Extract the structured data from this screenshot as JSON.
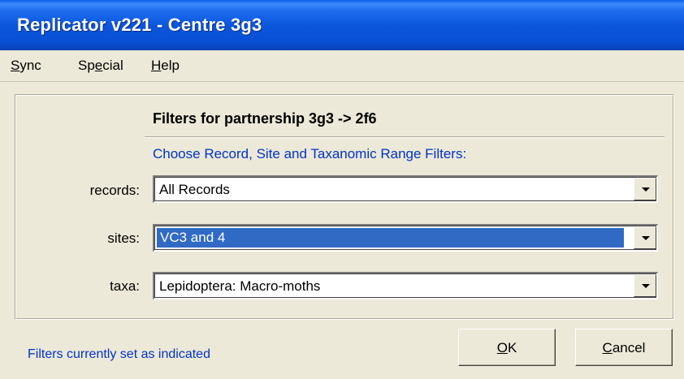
{
  "window": {
    "title": "Replicator v221 - Centre 3g3"
  },
  "menu": {
    "items": [
      {
        "label_first": "S",
        "label_rest": "ync"
      },
      {
        "label_first": "Sp",
        "label_under": "e",
        "label_rest": "cial"
      },
      {
        "label_first": "H",
        "label_rest": "elp"
      }
    ]
  },
  "filters": {
    "heading": "Filters for partnership 3g3 -> 2f6",
    "subheading": "Choose Record, Site and Taxanomic Range Filters:",
    "rows": [
      {
        "label": "records:",
        "value": "All Records",
        "selected": false
      },
      {
        "label": "sites:",
        "value": "VC3 and 4",
        "selected": true
      },
      {
        "label": "taxa:",
        "value": "Lepidoptera: Macro-moths",
        "selected": false
      }
    ]
  },
  "status": "Filters currently set as indicated",
  "buttons": {
    "ok_u": "O",
    "ok_rest": "K",
    "cancel_u": "C",
    "cancel_rest": "ancel"
  },
  "colors": {
    "accent": "#0033cc",
    "selection": "#316ac5",
    "titlebar": "#0a50d6"
  }
}
